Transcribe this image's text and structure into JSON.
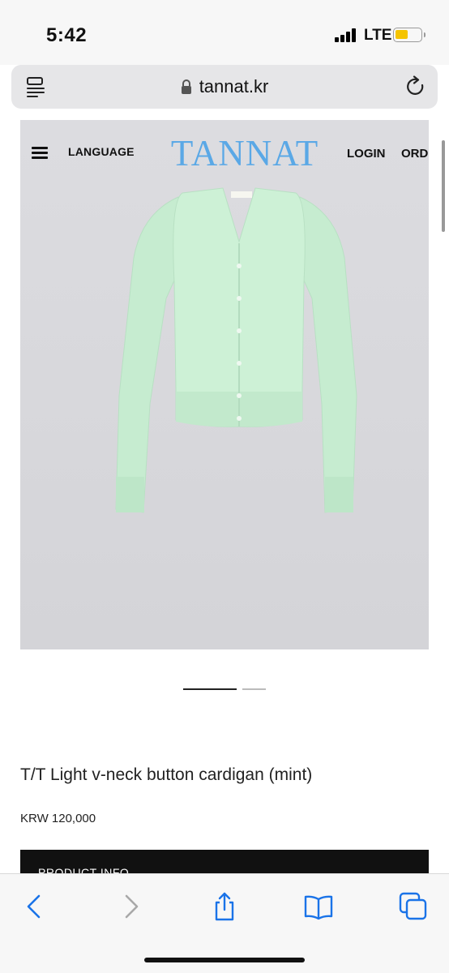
{
  "status_bar": {
    "time": "5:42",
    "network": "LTE",
    "battery_level": 0.5
  },
  "url_bar": {
    "domain": "tannat.kr"
  },
  "site": {
    "nav": {
      "language": "LANGUAGE",
      "logo": "TANNAT",
      "login": "LOGIN",
      "order": "ORDER"
    },
    "product": {
      "title": "T/T Light v-neck button cardigan (mint)",
      "price": "KRW 120,000",
      "info_label": "PRODUCT INFO"
    },
    "carousel": {
      "total_slides": 2,
      "active_slide": 1
    }
  },
  "colors": {
    "logo": "#5aa8e6",
    "cardigan": "#c9efd2",
    "battery": "#f5c400",
    "safari_blue": "#1a73e8"
  },
  "icons": {
    "reader": "reader-mode-icon",
    "lock": "lock-icon",
    "reload": "reload-icon",
    "menu": "hamburger-menu-icon",
    "back": "back-chevron-icon",
    "forward": "forward-chevron-icon",
    "share": "share-icon",
    "bookmarks": "book-icon",
    "tabs": "tabs-icon"
  }
}
